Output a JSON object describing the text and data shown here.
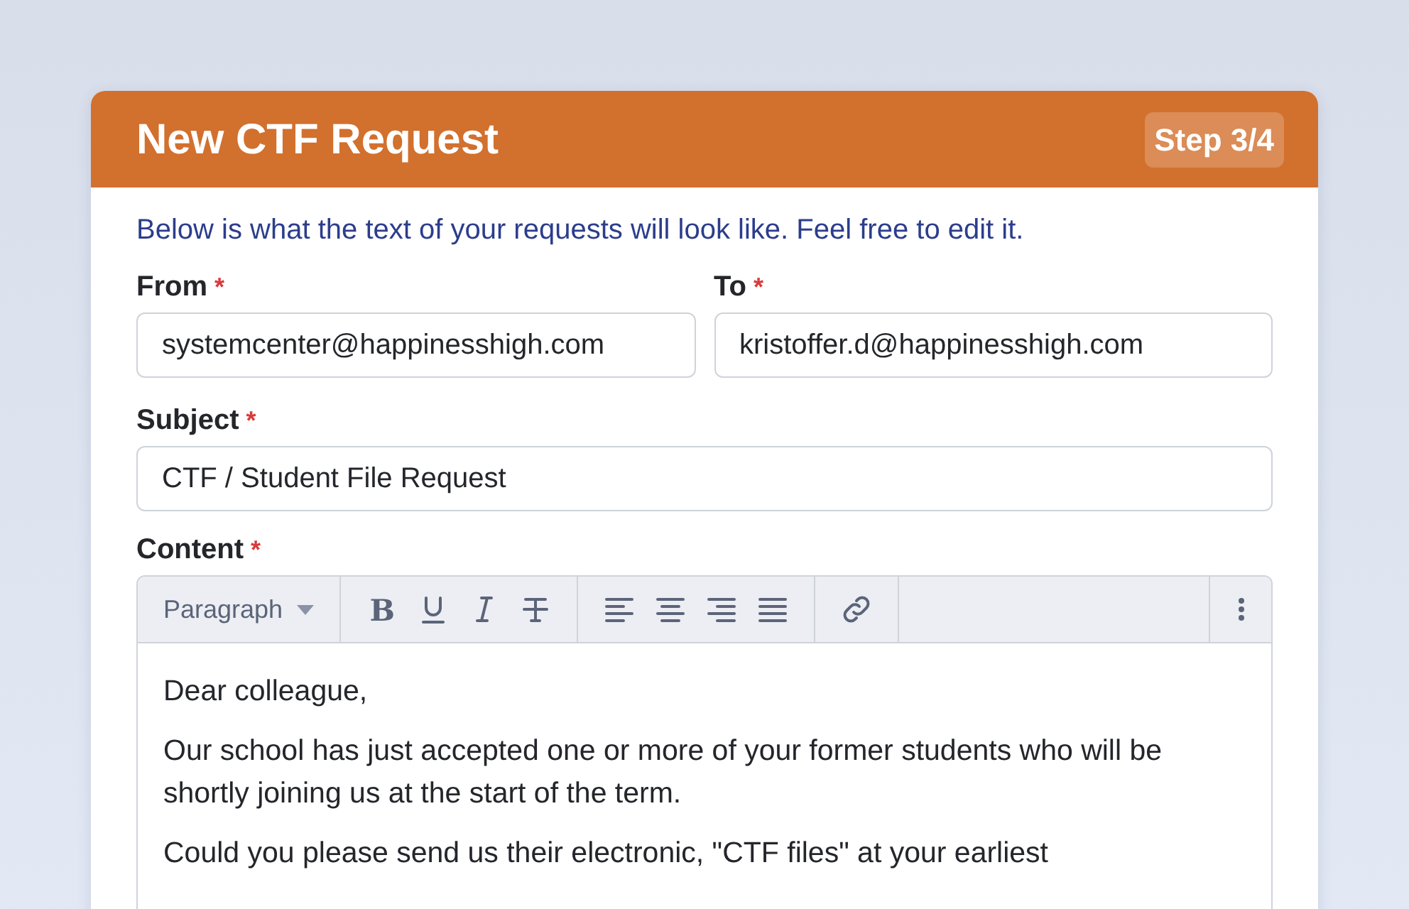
{
  "dialog": {
    "title": "New CTF Request",
    "step": "Step 3/4"
  },
  "intro": "Below is what the text of your requests will look like. Feel free to edit it.",
  "fields": [
    {
      "label": "From",
      "required_mark": "*",
      "value": "systemcenter@happinesshigh.com"
    },
    {
      "label": "To",
      "required_mark": "*",
      "value": "kristoffer.d@happinesshigh.com"
    },
    {
      "label": "Subject",
      "required_mark": "*",
      "value": "CTF / Student File Request"
    }
  ],
  "content": {
    "label": "Content",
    "required_mark": "*",
    "toolbar": {
      "block_format": "Paragraph",
      "groups": [
        [
          {
            "kind": "bold",
            "glyph": "B"
          },
          {
            "kind": "underline"
          },
          {
            "kind": "italic"
          },
          {
            "kind": "strike"
          }
        ],
        [
          {
            "kind": "align-left"
          },
          {
            "kind": "align-center"
          },
          {
            "kind": "align-right"
          },
          {
            "kind": "justify"
          }
        ],
        [
          {
            "kind": "link"
          }
        ]
      ]
    },
    "paragraphs": [
      "Dear colleague,",
      "Our school has just accepted one or more of your former students who will be shortly joining us at the start of the term.",
      "Could you please send us their electronic, \"CTF files\" at your earliest"
    ]
  }
}
